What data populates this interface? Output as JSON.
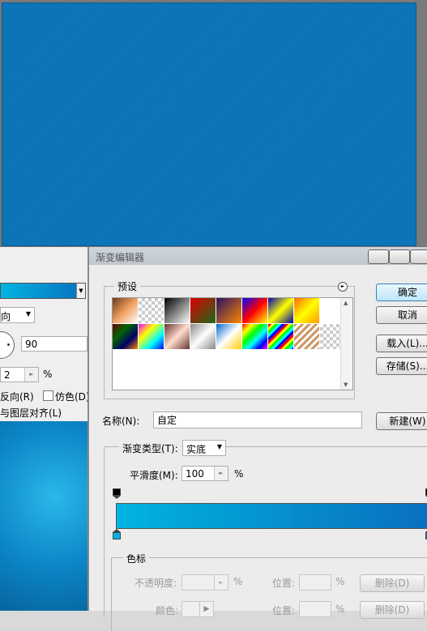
{
  "left_panel": {
    "direction_value": "向",
    "angle_value": "90",
    "scale_value": "2",
    "percent": "%",
    "reverse_label": "反向(R)",
    "dither_label": "仿色(D)",
    "align_label": "与图层对齐(L)"
  },
  "dialog": {
    "title": "渐变编辑器",
    "presets_label": "预设",
    "ok_label": "确定",
    "cancel_label": "取消",
    "load_label": "载入(L)...",
    "save_label": "存储(S)...",
    "name_label": "名称(N):",
    "name_value": "自定",
    "new_label": "新建(W)",
    "gradient_type_label": "渐变类型(T):",
    "gradient_type_value": "实底",
    "smoothness_label": "平滑度(M):",
    "smoothness_value": "100",
    "percent": "%",
    "color_stops_label": "色标",
    "opacity_label": "不透明度:",
    "location_label": "位置:",
    "delete_label": "删除(D)",
    "color_label": "颜色:",
    "gradient_colors": [
      "#00b4e0",
      "#0a6fc0"
    ]
  }
}
